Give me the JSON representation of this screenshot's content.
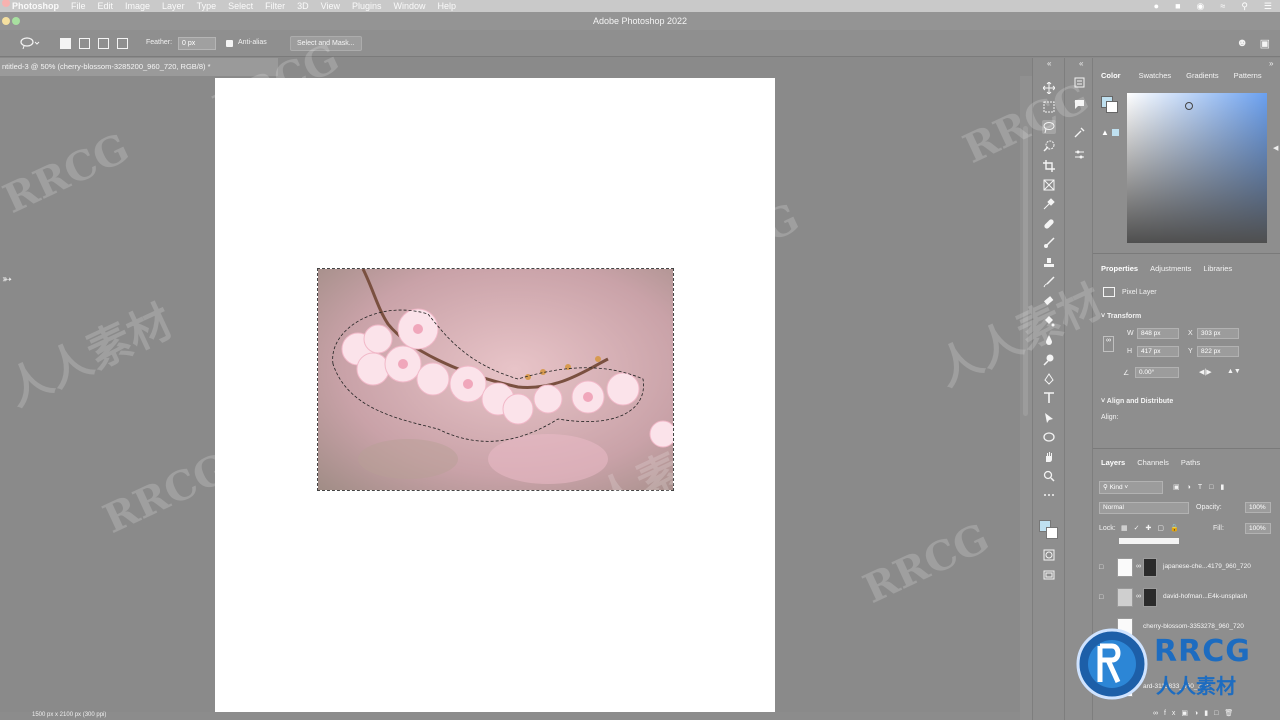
{
  "menubar": {
    "app": "Photoshop",
    "items": [
      "File",
      "Edit",
      "Image",
      "Layer",
      "Type",
      "Select",
      "Filter",
      "3D",
      "View",
      "Plugins",
      "Window",
      "Help"
    ]
  },
  "window": {
    "title": "Adobe Photoshop 2022"
  },
  "options_bar": {
    "feather_label": "Feather:",
    "feather_value": "0 px",
    "anti_alias_label": "Anti-alias",
    "select_mask_label": "Select and Mask..."
  },
  "document": {
    "tab_title": "ntitled-3 @ 50% (cherry-blossom-3285200_960_720, RGB/8) *",
    "status": "1500 px x 2100 px (300 ppi)"
  },
  "color_panel": {
    "tabs": [
      "Color",
      "Swatches",
      "Gradients",
      "Patterns"
    ],
    "foreground": "#bfe0f0",
    "background": "#ffffff"
  },
  "properties_panel": {
    "tabs": [
      "Properties",
      "Adjustments",
      "Libraries"
    ],
    "layer_type": "Pixel Layer",
    "transform_label": "Transform",
    "w_label": "W",
    "w_value": "848 px",
    "h_label": "H",
    "h_value": "417 px",
    "x_label": "X",
    "x_value": "303 px",
    "y_label": "Y",
    "y_value": "822 px",
    "angle_value": "0.00°",
    "align_section": "Align and Distribute",
    "align_label": "Align:"
  },
  "layers_panel": {
    "tabs": [
      "Layers",
      "Channels",
      "Paths"
    ],
    "kind_label": "Kind",
    "blend_mode": "Normal",
    "opacity_label": "Opacity:",
    "opacity_value": "100%",
    "lock_label": "Lock:",
    "fill_label": "Fill:",
    "fill_value": "100%",
    "layers": [
      {
        "name": "japanese-che...4179_960_720"
      },
      {
        "name": "david-hofman...E4k-unsplash"
      },
      {
        "name": "cherry-blossom-3353278_960_720"
      },
      {
        "name": "ard-3113833_960_720"
      }
    ]
  },
  "watermark": {
    "text_latin": "RRCG",
    "text_cn": "人人素材"
  },
  "logo": {
    "text_latin": "RRCG",
    "text_cn": "人人素材"
  }
}
